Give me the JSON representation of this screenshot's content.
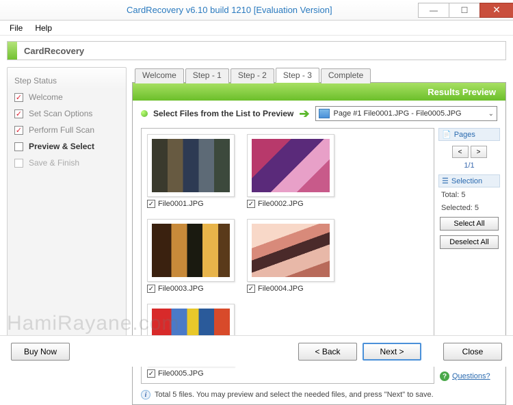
{
  "window": {
    "title": "CardRecovery v6.10 build 1210 [Evaluation Version]"
  },
  "menu": {
    "file": "File",
    "help": "Help"
  },
  "banner": {
    "title": "CardRecovery"
  },
  "sidebar": {
    "heading": "Step Status",
    "steps": [
      {
        "label": "Welcome",
        "state": "done"
      },
      {
        "label": "Set Scan Options",
        "state": "done"
      },
      {
        "label": "Perform Full Scan",
        "state": "done"
      },
      {
        "label": "Preview & Select",
        "state": "current"
      },
      {
        "label": "Save & Finish",
        "state": "pending"
      }
    ]
  },
  "tabs": [
    "Welcome",
    "Step - 1",
    "Step - 2",
    "Step - 3",
    "Complete"
  ],
  "active_tab": 3,
  "panel": {
    "header": "Results Preview",
    "instruction": "Select Files from the List to Preview",
    "page_selector": "Page #1     File0001.JPG - File0005.JPG"
  },
  "files": [
    {
      "name": "File0001.JPG",
      "checked": true
    },
    {
      "name": "File0002.JPG",
      "checked": true
    },
    {
      "name": "File0003.JPG",
      "checked": true
    },
    {
      "name": "File0004.JPG",
      "checked": true
    },
    {
      "name": "File0005.JPG",
      "checked": true
    }
  ],
  "rside": {
    "pages_label": "Pages",
    "prev": "<",
    "next": ">",
    "page_indicator": "1/1",
    "selection_label": "Selection",
    "total_label": "Total:  5",
    "selected_label": "Selected:  5",
    "select_all": "Select All",
    "deselect_all": "Deselect All",
    "questions": "Questions?"
  },
  "status": "Total 5 files.  You may preview and select the needed files, and press \"Next\" to save.",
  "buttons": {
    "buy": "Buy Now",
    "back": "<  Back",
    "next": "Next  >",
    "close": "Close"
  },
  "watermark": "HamiRayane.com"
}
